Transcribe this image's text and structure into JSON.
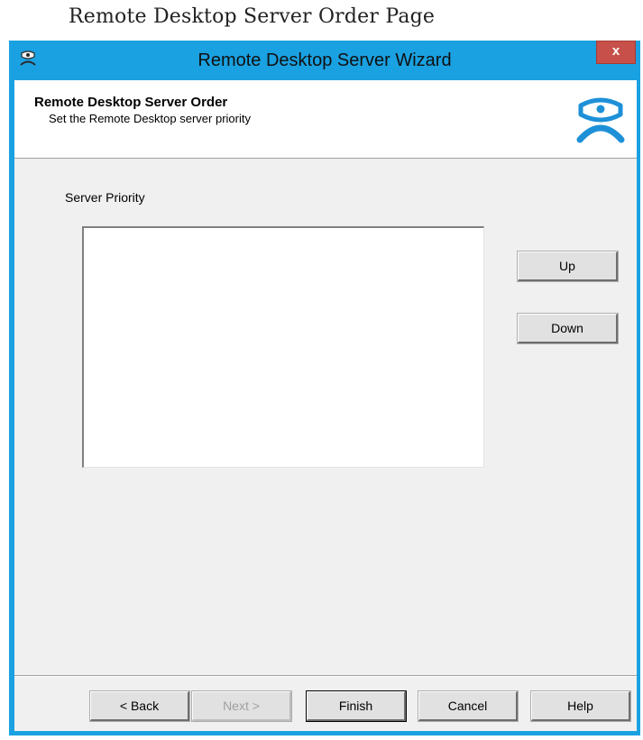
{
  "page_caption": "Remote Desktop Server Order Page",
  "window": {
    "title": "Remote Desktop Server Wizard",
    "close_label": "x"
  },
  "header": {
    "title": "Remote Desktop Server Order",
    "subtitle": "Set the Remote Desktop server priority"
  },
  "content": {
    "list_label": "Server Priority",
    "list_items": [],
    "up_label": "Up",
    "down_label": "Down"
  },
  "footer": {
    "back_label": "< Back",
    "next_label": "Next >",
    "finish_label": "Finish",
    "cancel_label": "Cancel",
    "help_label": "Help"
  },
  "icons": {
    "app_icon": "terminal-mask-icon",
    "logo": "thinmanager-logo-icon"
  },
  "colors": {
    "titlebar": "#1aa1e1",
    "close_button": "#c7514a",
    "dialog_background": "#f0f0f0",
    "logo_blue": "#1e90d8"
  }
}
